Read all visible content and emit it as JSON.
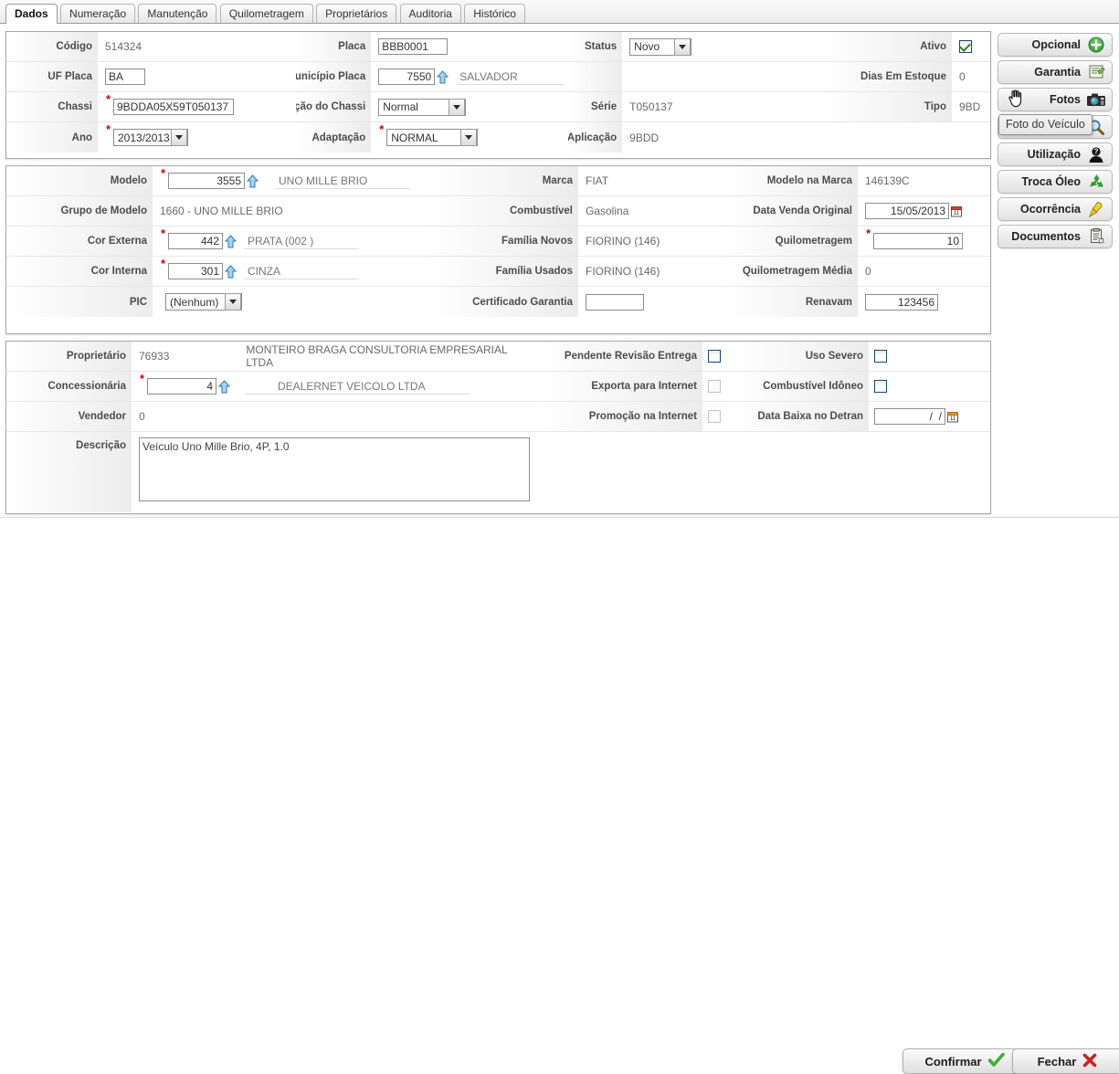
{
  "tabs": [
    {
      "label": "Dados",
      "active": true
    },
    {
      "label": "Numeração",
      "active": false
    },
    {
      "label": "Manutenção",
      "active": false
    },
    {
      "label": "Quilometragem",
      "active": false
    },
    {
      "label": "Proprietários",
      "active": false
    },
    {
      "label": "Auditoria",
      "active": false
    },
    {
      "label": "Histórico",
      "active": false
    }
  ],
  "panel1": {
    "codigo_label": "Código",
    "codigo_value": "514324",
    "placa_label": "Placa",
    "placa_value": "BBB0001",
    "status_label": "Status",
    "status_value": "Novo",
    "ativo_label": "Ativo",
    "uf_placa_label": "UF Placa",
    "uf_placa_value": "BA",
    "municipio_placa_label": "Município Placa",
    "municipio_placa_code": "7550",
    "municipio_placa_name": "SALVADOR",
    "dias_estoque_label": "Dias Em Estoque",
    "dias_estoque_value": "0",
    "chassi_label": "Chassi",
    "chassi_value": "9BDDA05X59T050137",
    "condicao_chassi_label": "Condição do Chassi",
    "condicao_chassi_value": "Normal",
    "serie_label": "Série",
    "serie_value": "T050137",
    "tipo_label": "Tipo",
    "tipo_value": "9BD",
    "ano_label": "Ano",
    "ano_value": "2013/2013",
    "adaptacao_label": "Adaptação",
    "adaptacao_value": "NORMAL",
    "aplicacao_label": "Aplicação",
    "aplicacao_value": "9BDD"
  },
  "panel2": {
    "modelo_label": "Modelo",
    "modelo_code": "3555",
    "modelo_name": "UNO MILLE BRIO",
    "marca_label": "Marca",
    "marca_value": "FIAT",
    "modelo_na_marca_label": "Modelo na Marca",
    "modelo_na_marca_value": "146139C",
    "grupo_modelo_label": "Grupo de Modelo",
    "grupo_modelo_value": "1660 - UNO MILLE BRIO",
    "combustivel_label": "Combustível",
    "combustivel_value": "Gasolina",
    "data_venda_label": "Data Venda Original",
    "data_venda_value": "15/05/2013",
    "cor_externa_label": "Cor Externa",
    "cor_externa_code": "442",
    "cor_externa_name": "PRATA (002 )",
    "familia_novos_label": "Família Novos",
    "familia_novos_value": "FIORINO (146)",
    "quilometragem_label": "Quilometragem",
    "quilometragem_value": "10",
    "cor_interna_label": "Cor Interna",
    "cor_interna_code": "301",
    "cor_interna_name": "CINZA",
    "familia_usados_label": "Família Usados",
    "familia_usados_value": "FIORINO (146)",
    "quilometragem_media_label": "Quilometragem Média",
    "quilometragem_media_value": "0",
    "pic_label": "PIC",
    "pic_value": "(Nenhum)",
    "certificado_garantia_label": "Certificado Garantia",
    "certificado_garantia_value": "",
    "renavam_label": "Renavam",
    "renavam_value": "123456"
  },
  "panel3": {
    "proprietario_label": "Proprietário",
    "proprietario_code": "76933",
    "proprietario_name": "MONTEIRO BRAGA CONSULTORIA EMPRESARIAL LTDA",
    "pendente_revisao_label": "Pendente Revisão Entrega",
    "uso_severo_label": "Uso Severo",
    "concessionaria_label": "Concessionária",
    "concessionaria_code": "4",
    "concessionaria_name": "DEALERNET VEICOLO LTDA",
    "exporta_internet_label": "Exporta para Internet",
    "combustivel_idoneo_label": "Combustível Idôneo",
    "vendedor_label": "Vendedor",
    "vendedor_value": "0",
    "promocao_internet_label": "Promoção na Internet",
    "data_baixa_label": "Data Baixa no Detran",
    "data_baixa_value": "  /  /",
    "descricao_label": "Descrição",
    "descricao_value": "Veículo Uno Mille Brio, 4P, 1.0"
  },
  "sidebar": {
    "buttons": [
      {
        "label": "Opcional",
        "icon": "plus-circle-icon"
      },
      {
        "label": "Garantia",
        "icon": "certificate-icon"
      },
      {
        "label": "Fotos",
        "icon": "camera-icon"
      },
      {
        "label": "",
        "icon": "magnifier-icon"
      },
      {
        "label": "Utilização",
        "icon": "person-question-icon"
      },
      {
        "label": "Troca Óleo",
        "icon": "recycle-icon"
      },
      {
        "label": "Ocorrência",
        "icon": "pushpin-icon"
      },
      {
        "label": "Documentos",
        "icon": "document-icon"
      }
    ],
    "tooltip": "Foto do Veículo"
  },
  "footer": {
    "confirmar_label": "Confirmar",
    "fechar_label": "Fechar"
  },
  "colors": {
    "accent_blue": "#12497a",
    "required_red": "#d40000",
    "check_green": "#1f8b2a",
    "close_red": "#cc2222"
  }
}
